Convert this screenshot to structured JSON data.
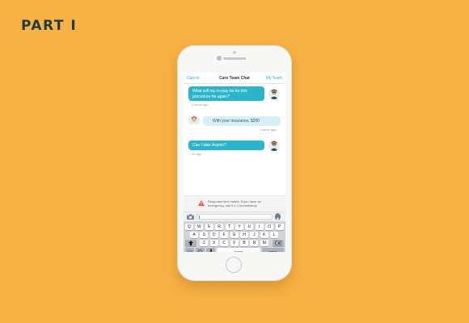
{
  "heading": {
    "title": "PART I"
  },
  "nav": {
    "cancel": "Cancel",
    "title": "Care Team Chat",
    "my_team": "My Team"
  },
  "messages": [
    {
      "side": "me",
      "text": "What will my co-pay be for this procedure be again?",
      "time": "1 week ago"
    },
    {
      "side": "them",
      "text": "With your insurance, $200",
      "time": "1 week ago"
    },
    {
      "side": "me",
      "text": "Can I take Aspirin?",
      "time": "2h ago"
    }
  ],
  "notice": {
    "icon": "warning-icon",
    "text": "Response time varies. If you have an emergency, call 9-1-1 immediately."
  },
  "input": {
    "camera_icon": "camera-icon",
    "mic_icon": "microphone-icon"
  },
  "keyboard": {
    "row1": [
      "Q",
      "W",
      "E",
      "R",
      "T",
      "Y",
      "U",
      "I",
      "O",
      "P"
    ],
    "row2": [
      "A",
      "S",
      "D",
      "F",
      "G",
      "H",
      "J",
      "K",
      "L"
    ],
    "row3": [
      "Z",
      "X",
      "C",
      "V",
      "B",
      "N",
      "M"
    ],
    "numbers": "123",
    "space": "space",
    "return": "return"
  },
  "colors": {
    "background": "#F8B244",
    "accent": "#2AB5CB",
    "title": "#1F3C41"
  }
}
